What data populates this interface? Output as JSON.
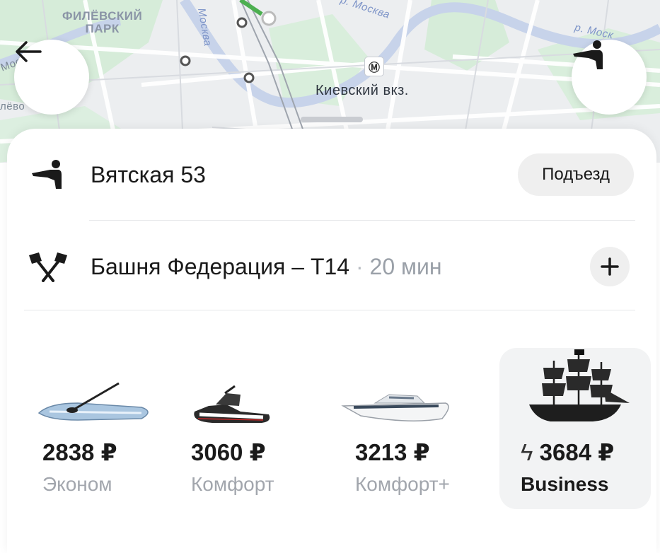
{
  "map": {
    "labels": {
      "park_line1": "ФИЛЁВСКИЙ",
      "park_line2": "ПАРК",
      "river_1": "р. Москва",
      "river_2": "р. Моск",
      "river_3": "Москва",
      "station": "Киевский вкз.",
      "edge_left_1": "Мосва",
      "edge_left_2": "лёво"
    },
    "metro_icon": "metro-station-icon",
    "back_button_icon": "arrow-left-icon",
    "pickup_button_icon": "pickup-person-icon"
  },
  "route": {
    "from": {
      "address": "Вятская 53",
      "entrance_button": "Подъезд",
      "icon": "pickup-person-icon"
    },
    "to": {
      "address": "Башня Федерация – Т14",
      "separator": "·",
      "eta": "20 мин",
      "icon": "checkered-flags-icon",
      "add_stop_icon": "plus-icon"
    }
  },
  "tariffs": [
    {
      "price": "2838 ₽",
      "name": "Эконом",
      "image": "sup-board-image",
      "selected": false
    },
    {
      "price": "3060 ₽",
      "name": "Комфорт",
      "image": "jet-ski-image",
      "selected": false
    },
    {
      "price": "3213 ₽",
      "name": "Комфорт+",
      "image": "speedboat-image",
      "selected": false
    },
    {
      "price": "3684 ₽",
      "name": "Business",
      "image": "pirate-ship-image",
      "selected": true,
      "surge_icon": "lightning-icon",
      "surge_symbol": "ϟ"
    }
  ],
  "colors": {
    "accent_text": "#1a1a1a",
    "muted_text": "#a2a6ad",
    "map_green": "#cfe8d3",
    "route_green": "#4caf50"
  }
}
